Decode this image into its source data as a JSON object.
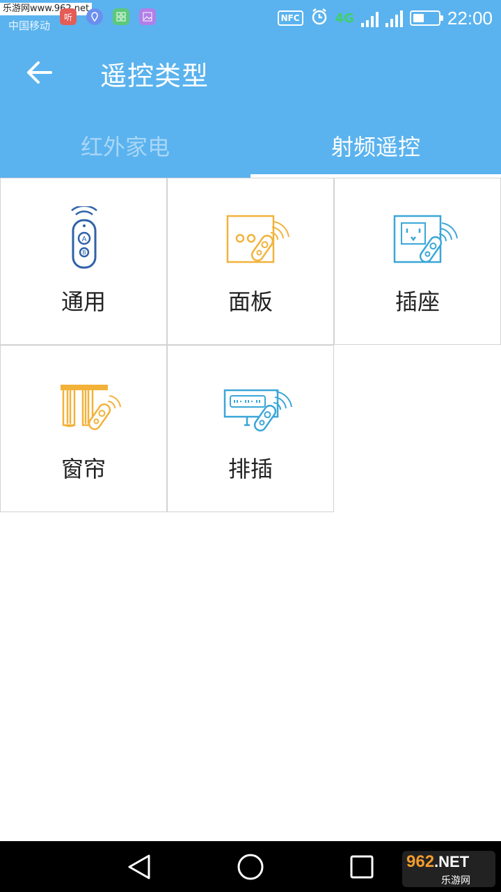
{
  "status_bar": {
    "watermark": "乐游网www.962.net",
    "carrier": "中国移动",
    "notif_icons": [
      "听",
      "",
      "",
      ""
    ],
    "nfc_label": "NFC",
    "network": "4G",
    "time": "22:00",
    "battery_level": 0.45
  },
  "app_bar": {
    "title": "遥控类型"
  },
  "tabs": [
    {
      "label": "红外家电",
      "active": false
    },
    {
      "label": "射频遥控",
      "active": true
    }
  ],
  "grid": {
    "items": [
      {
        "label": "通用",
        "icon": "universal-remote-icon"
      },
      {
        "label": "面板",
        "icon": "wall-panel-remote-icon"
      },
      {
        "label": "插座",
        "icon": "socket-remote-icon"
      },
      {
        "label": "窗帘",
        "icon": "curtain-remote-icon"
      },
      {
        "label": "排插",
        "icon": "power-strip-remote-icon"
      }
    ]
  },
  "watermark_bottom": {
    "brand": "962",
    "suffix": ".NET",
    "site": "乐游网"
  },
  "colors": {
    "header": "#5ab3ee",
    "icon_blue": "#2f62a8",
    "icon_orange": "#f2b23a",
    "icon_cyan": "#3aa6d8"
  }
}
